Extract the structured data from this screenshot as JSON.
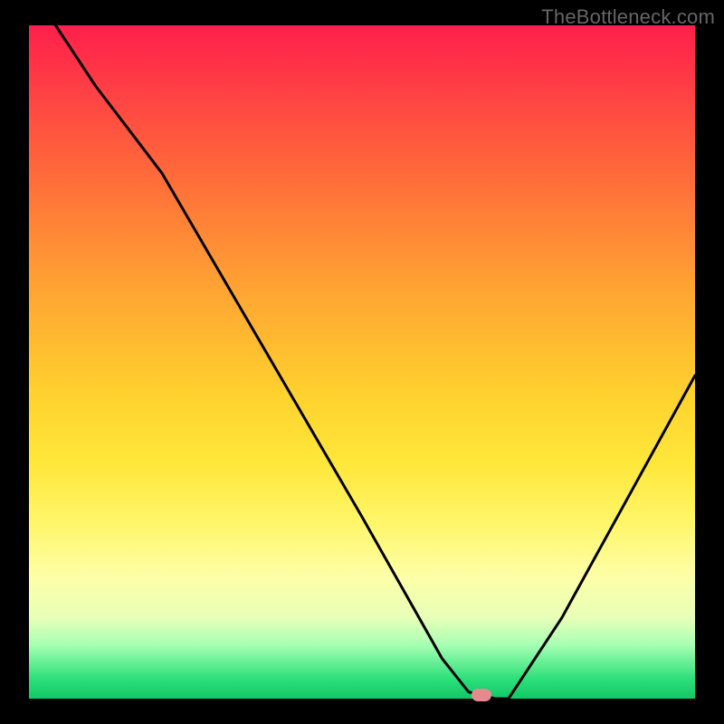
{
  "watermark": "TheBottleneck.com",
  "colors": {
    "background": "#000000",
    "curve": "#000000",
    "marker": "#e58b8f"
  },
  "chart_data": {
    "type": "line",
    "title": "",
    "xlabel": "",
    "ylabel": "",
    "xlim": [
      0,
      100
    ],
    "ylim": [
      0,
      100
    ],
    "grid": false,
    "legend": false,
    "series": [
      {
        "name": "bottleneck-curve",
        "x": [
          4,
          10,
          20,
          30,
          40,
          50,
          58,
          62,
          66,
          70,
          72,
          80,
          90,
          100
        ],
        "y": [
          100,
          91,
          78,
          61,
          44,
          27,
          13,
          6,
          1,
          0,
          0,
          12,
          30,
          48
        ]
      }
    ],
    "marker": {
      "x": 68,
      "y": 0
    },
    "gradient_stops": [
      {
        "pos": 0,
        "color": "#ff1f4b"
      },
      {
        "pos": 22,
        "color": "#ff6a3a"
      },
      {
        "pos": 55,
        "color": "#ffd22e"
      },
      {
        "pos": 82,
        "color": "#fdffa8"
      },
      {
        "pos": 97,
        "color": "#2de07a"
      },
      {
        "pos": 100,
        "color": "#11c867"
      }
    ]
  }
}
